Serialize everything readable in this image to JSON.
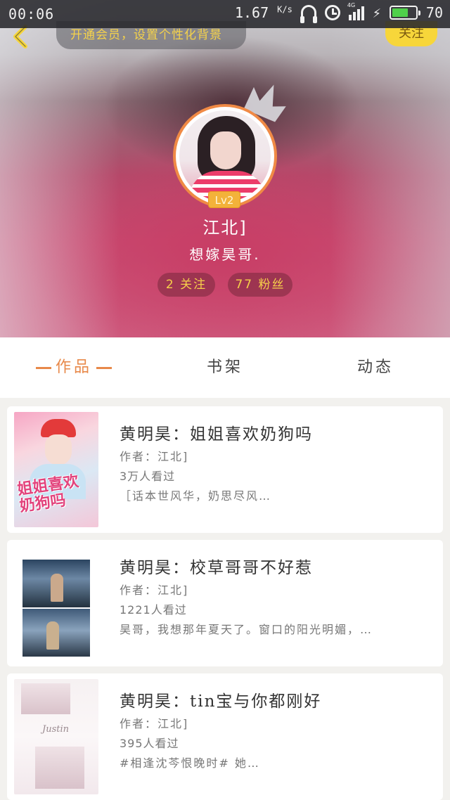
{
  "status_bar": {
    "time": "00:06",
    "speed": "1.67",
    "speed_unit": "K/s",
    "network": "4G",
    "battery": "70"
  },
  "header": {
    "vip_promo": "开通会员，设置个性化背景",
    "follow_label": "关注"
  },
  "profile": {
    "level": "Lv2",
    "username": "江北]",
    "signature": "想嫁昊哥.",
    "following": "2 关注",
    "fans": "77 粉丝"
  },
  "tabs": [
    {
      "label": "作品",
      "active": true
    },
    {
      "label": "书架",
      "active": false
    },
    {
      "label": "动态",
      "active": false
    }
  ],
  "books": [
    {
      "title": "黄明昊：姐姐喜欢奶狗吗",
      "author": "作者：江北]",
      "views": "3万人看过",
      "desc": "［话本世风华，奶思尽风…",
      "cover_text": "姐姐喜欢奶狗吗"
    },
    {
      "title": "黄明昊：校草哥哥不好惹",
      "author": "作者：江北]",
      "views": "1221人看过",
      "desc": "昊哥，我想那年夏天了。窗口的阳光明媚，…"
    },
    {
      "title": "黄明昊：tin宝与你都刚好",
      "author": "作者：江北]",
      "views": "395人看过",
      "desc": "#相逢沈芩恨晚时# 她…",
      "cover_text": "Justin"
    }
  ],
  "colors": {
    "accent_orange": "#e8894a",
    "follow_yellow": "#f7d63a",
    "stat_text": "#f6cf4a",
    "hero_pink": "#c84c72"
  }
}
